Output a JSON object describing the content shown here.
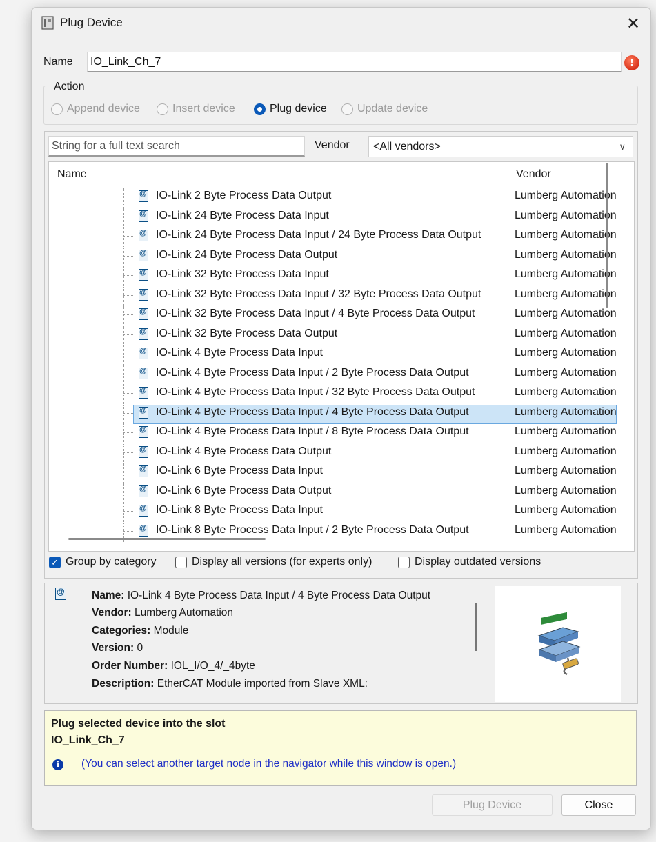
{
  "window": {
    "title": "Plug Device",
    "close_glyph": "✕"
  },
  "name_field": {
    "label": "Name",
    "value": "IO_Link_Ch_7",
    "error_icon": "!"
  },
  "action": {
    "legend": "Action",
    "options": [
      {
        "label": "Append device",
        "selected": false,
        "enabled": false
      },
      {
        "label": "Insert device",
        "selected": false,
        "enabled": false
      },
      {
        "label": "Plug device",
        "selected": true,
        "enabled": true
      },
      {
        "label": "Update device",
        "selected": false,
        "enabled": false
      }
    ]
  },
  "search": {
    "placeholder": "String for a full text search",
    "value": ""
  },
  "vendor_filter": {
    "label": "Vendor",
    "value": "<All vendors>"
  },
  "list": {
    "columns": {
      "name": "Name",
      "vendor": "Vendor"
    },
    "rows": [
      {
        "name": "IO-Link 2 Byte Process Data Output",
        "vendor": "Lumberg Automation"
      },
      {
        "name": "IO-Link 24 Byte Process Data Input",
        "vendor": "Lumberg Automation"
      },
      {
        "name": "IO-Link 24 Byte Process Data Input / 24 Byte Process Data Output",
        "vendor": "Lumberg Automation"
      },
      {
        "name": "IO-Link 24 Byte Process Data Output",
        "vendor": "Lumberg Automation"
      },
      {
        "name": "IO-Link 32 Byte Process Data Input",
        "vendor": "Lumberg Automation"
      },
      {
        "name": "IO-Link 32 Byte Process Data Input / 32 Byte Process Data Output",
        "vendor": "Lumberg Automation"
      },
      {
        "name": "IO-Link 32 Byte Process Data Input / 4 Byte Process Data Output",
        "vendor": "Lumberg Automation"
      },
      {
        "name": "IO-Link 32 Byte Process Data Output",
        "vendor": "Lumberg Automation"
      },
      {
        "name": "IO-Link 4 Byte Process Data Input",
        "vendor": "Lumberg Automation"
      },
      {
        "name": "IO-Link 4 Byte Process Data Input / 2 Byte Process Data Output",
        "vendor": "Lumberg Automation"
      },
      {
        "name": "IO-Link 4 Byte Process Data Input / 32 Byte Process Data Output",
        "vendor": "Lumberg Automation"
      },
      {
        "name": "IO-Link 4 Byte Process Data Input / 4 Byte Process Data Output",
        "vendor": "Lumberg Automation",
        "selected": true
      },
      {
        "name": "IO-Link 4 Byte Process Data Input / 8 Byte Process Data Output",
        "vendor": "Lumberg Automation"
      },
      {
        "name": "IO-Link 4 Byte Process Data Output",
        "vendor": "Lumberg Automation"
      },
      {
        "name": "IO-Link 6 Byte Process Data Input",
        "vendor": "Lumberg Automation"
      },
      {
        "name": "IO-Link 6 Byte Process Data Output",
        "vendor": "Lumberg Automation"
      },
      {
        "name": "IO-Link 8 Byte Process Data Input",
        "vendor": "Lumberg Automation"
      },
      {
        "name": "IO-Link 8 Byte Process Data Input / 2 Byte Process Data Output",
        "vendor": "Lumberg Automation"
      }
    ]
  },
  "options": {
    "group_by_category": {
      "label": "Group by category",
      "checked": true
    },
    "display_all_versions": {
      "label": "Display all versions (for experts only)",
      "checked": false
    },
    "display_outdated": {
      "label": "Display outdated versions",
      "checked": false
    }
  },
  "details": {
    "name_label": "Name:",
    "name": "IO-Link 4 Byte Process Data Input / 4 Byte Process Data Output",
    "vendor_label": "Vendor:",
    "vendor": "Lumberg Automation",
    "categories_label": "Categories:",
    "categories": "Module",
    "version_label": "Version:",
    "version": "0",
    "order_label": "Order Number:",
    "order": "IOL_I/O_4/_4byte",
    "description_label": "Description:",
    "description": "EtherCAT Module imported from Slave XML:"
  },
  "info": {
    "line1": "Plug selected device into the slot",
    "line2": "IO_Link_Ch_7",
    "icon": "i",
    "note": "(You can select another target node in the navigator while this window is open.)"
  },
  "buttons": {
    "plug": "Plug Device",
    "close": "Close"
  },
  "colors": {
    "accent": "#0a59b8",
    "selection": "#cce4f7",
    "info_bg": "#fcfcdc",
    "note_text": "#1f2fc6"
  }
}
